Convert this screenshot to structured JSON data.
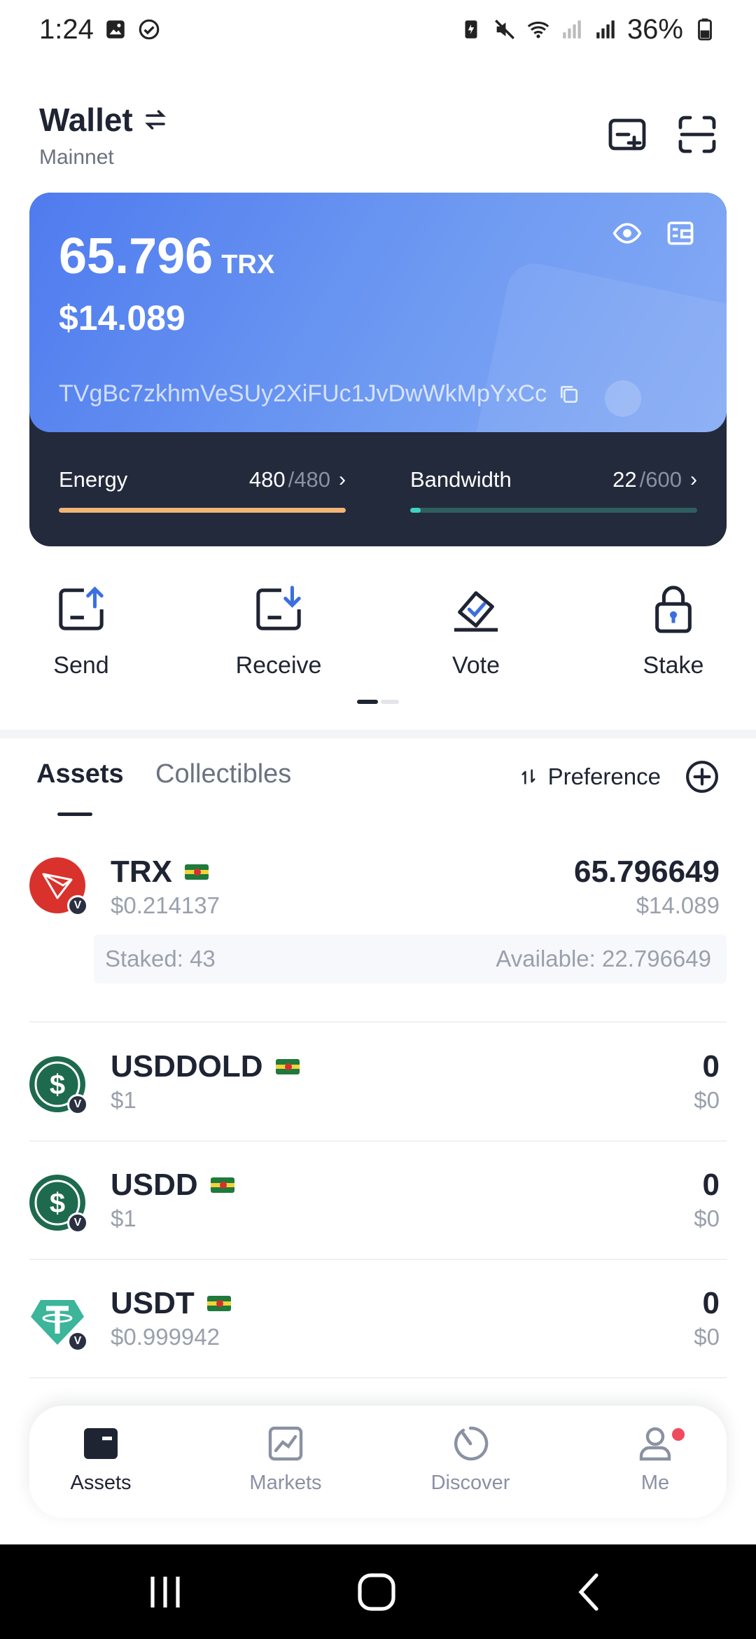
{
  "status_bar": {
    "time": "1:24",
    "battery": "36%"
  },
  "header": {
    "title": "Wallet",
    "network": "Mainnet"
  },
  "balance": {
    "amount": "65.796",
    "unit": "TRX",
    "usd": "$14.089",
    "address": "TVgBc7zkhmVeSUy2XiFUc1JvDwWkMpYxCc"
  },
  "resources": {
    "energy": {
      "label": "Energy",
      "current": "480",
      "max": "/480",
      "fill_fraction": 1.0,
      "color": "#f2b477"
    },
    "bandwidth": {
      "label": "Bandwidth",
      "current": "22",
      "max": "/600",
      "fill_fraction": 0.037,
      "color": "#3ed3c1"
    }
  },
  "actions": [
    {
      "label": "Send",
      "icon": "send-icon"
    },
    {
      "label": "Receive",
      "icon": "receive-icon"
    },
    {
      "label": "Vote",
      "icon": "vote-icon"
    },
    {
      "label": "Stake",
      "icon": "stake-icon"
    }
  ],
  "tabs": {
    "assets": "Assets",
    "collectibles": "Collectibles",
    "preference": "Preference"
  },
  "assets": [
    {
      "name": "TRX",
      "price": "$0.214137",
      "amount": "65.796649",
      "value": "$14.089",
      "staked": "Staked: 43",
      "available": "Available: 22.796649",
      "icon": "trx-icon"
    },
    {
      "name": "USDDOLD",
      "price": "$1",
      "amount": "0",
      "value": "$0",
      "icon": "usdd-icon"
    },
    {
      "name": "USDD",
      "price": "$1",
      "amount": "0",
      "value": "$0",
      "icon": "usdd-icon"
    },
    {
      "name": "USDT",
      "price": "$0.999942",
      "amount": "0",
      "value": "$0",
      "icon": "usdt-icon"
    }
  ],
  "bottom_nav": [
    {
      "label": "Assets",
      "icon": "wallet-icon",
      "active": true
    },
    {
      "label": "Markets",
      "icon": "chart-icon",
      "active": false
    },
    {
      "label": "Discover",
      "icon": "discover-icon",
      "active": false
    },
    {
      "label": "Me",
      "icon": "user-icon",
      "active": false,
      "badge": true
    }
  ],
  "colors": {
    "card_gradient_start": "#4f7bef",
    "card_gradient_end": "#86abf5",
    "card_dark": "#232a3c",
    "trx_red": "#d9322c",
    "usdd_green": "#1e6a4f",
    "usdt_teal": "#3cb59a",
    "accent_blue": "#3b6fe0",
    "notification": "#f04a5d"
  }
}
